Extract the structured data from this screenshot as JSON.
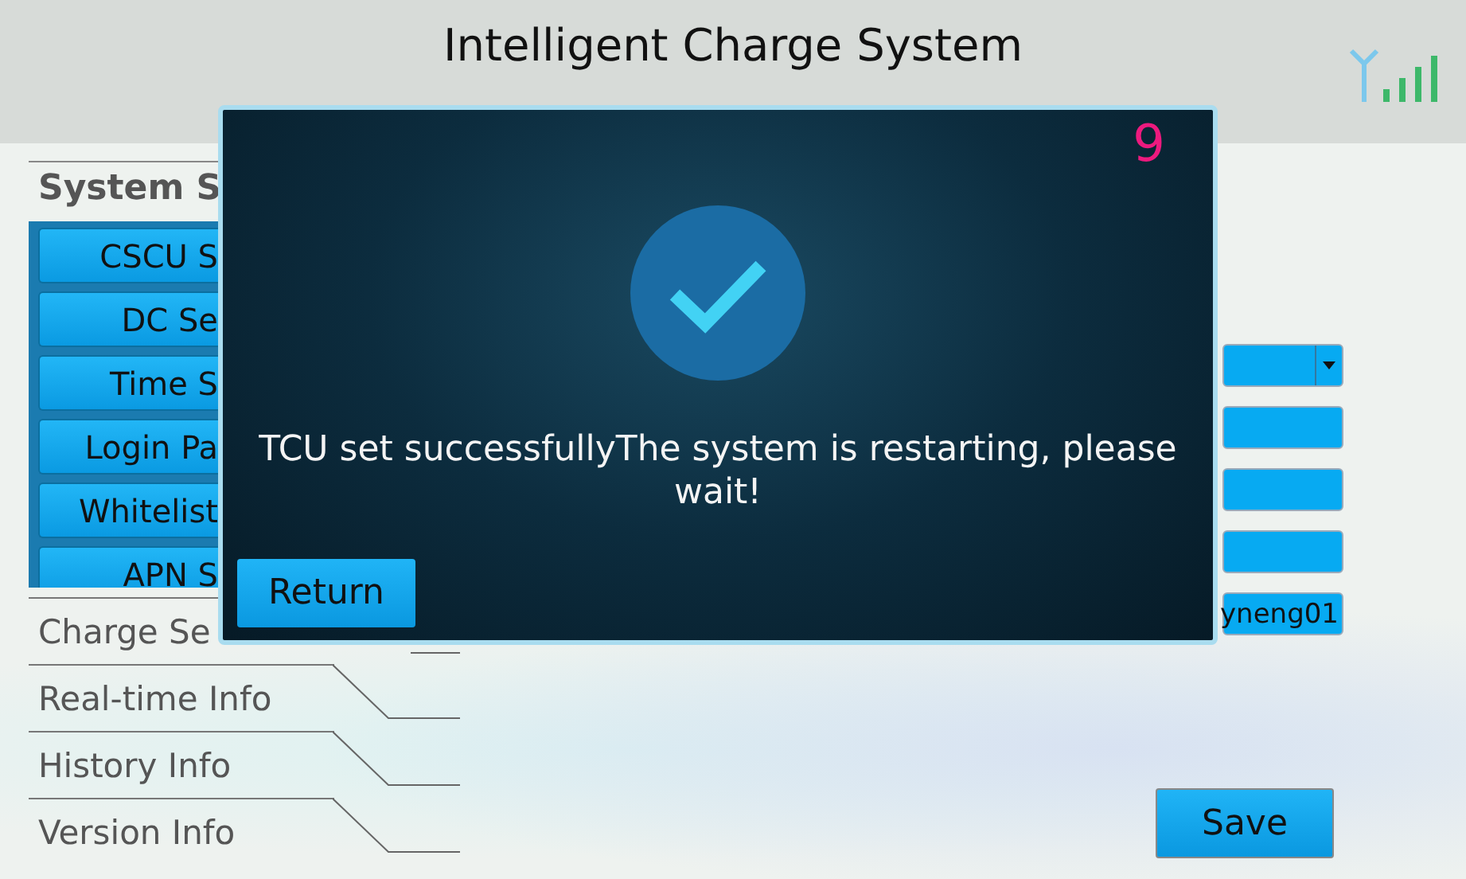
{
  "header": {
    "title": "Intelligent Charge System"
  },
  "sidebar": {
    "title": "System S",
    "buttons": [
      "CSCU S",
      "DC Se",
      "Time S",
      "Login Pa",
      "Whitelist",
      "APN S"
    ],
    "nav": [
      "Charge Se",
      "Real-time Info",
      "History Info",
      "Version Info"
    ]
  },
  "fields": [
    {
      "kind": "dropdown"
    },
    {
      "kind": "text"
    },
    {
      "kind": "text"
    },
    {
      "kind": "text"
    },
    {
      "kind": "text",
      "value": "yneng01"
    }
  ],
  "save_button": "Save",
  "dialog": {
    "countdown": "9",
    "message": "TCU set successfullyThe system is restarting, please wait!",
    "return_button": "Return"
  }
}
